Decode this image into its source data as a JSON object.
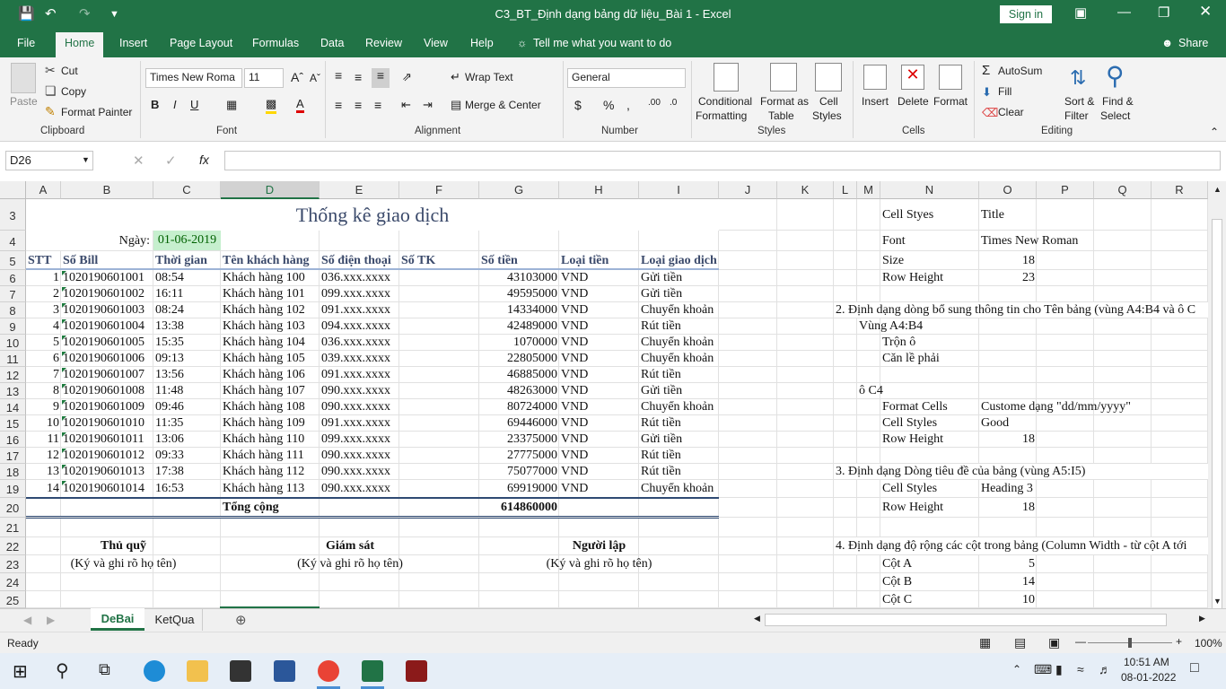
{
  "window": {
    "title": "C3_BT_Định dạng bảng dữ liệu_Bài 1  -  Excel",
    "signin": "Sign in"
  },
  "tabs": [
    "File",
    "Home",
    "Insert",
    "Page Layout",
    "Formulas",
    "Data",
    "Review",
    "View",
    "Help"
  ],
  "tell_me": "Tell me what you want to do",
  "share": "Share",
  "ribbon": {
    "paste": "Paste",
    "cut": "Cut",
    "copy": "Copy",
    "format_painter": "Format Painter",
    "clipboard": "Clipboard",
    "font_name": "Times New Roma",
    "font_size": "11",
    "font": "Font",
    "wrap": "Wrap Text",
    "merge": "Merge & Center",
    "alignment": "Alignment",
    "number_format": "General",
    "number": "Number",
    "cond1": "Conditional",
    "cond2": "Formatting",
    "fmt_table1": "Format as",
    "fmt_table2": "Table",
    "cell_styles1": "Cell",
    "cell_styles2": "Styles",
    "styles": "Styles",
    "insert": "Insert",
    "delete": "Delete",
    "format": "Format",
    "cells": "Cells",
    "autosum": "AutoSum",
    "fill": "Fill",
    "clear": "Clear",
    "sort1": "Sort &",
    "sort2": "Filter",
    "find1": "Find &",
    "find2": "Select",
    "editing": "Editing"
  },
  "namebox": "D26",
  "columns": [
    "A",
    "B",
    "C",
    "D",
    "E",
    "F",
    "G",
    "H",
    "I",
    "J",
    "K",
    "L",
    "M",
    "N",
    "O",
    "P",
    "Q",
    "R"
  ],
  "rows": [
    "3",
    "4",
    "5",
    "6",
    "7",
    "8",
    "9",
    "10",
    "11",
    "12",
    "13",
    "14",
    "15",
    "16",
    "17",
    "18",
    "19",
    "20",
    "21",
    "22",
    "23",
    "24",
    "25"
  ],
  "sheet": {
    "title": "Thống kê giao dịch",
    "date_label": "Ngày:",
    "date_value": "01-06-2019",
    "headers": [
      "STT",
      "Số Bill",
      "Thời gian",
      "Tên khách hàng",
      "Số điện thoại",
      "Số TK",
      "Số tiền",
      "Loại tiền",
      "Loại giao dịch"
    ],
    "data": [
      [
        "1",
        "1020190601001",
        "08:54",
        "Khách hàng 100",
        "036.xxx.xxxx",
        "",
        "43103000",
        "VND",
        "Gửi tiền"
      ],
      [
        "2",
        "1020190601002",
        "16:11",
        "Khách hàng 101",
        "099.xxx.xxxx",
        "",
        "49595000",
        "VND",
        "Gửi tiền"
      ],
      [
        "3",
        "1020190601003",
        "08:24",
        "Khách hàng 102",
        "091.xxx.xxxx",
        "",
        "14334000",
        "VND",
        "Chuyển khoản"
      ],
      [
        "4",
        "1020190601004",
        "13:38",
        "Khách hàng 103",
        "094.xxx.xxxx",
        "",
        "42489000",
        "VND",
        "Rút tiền"
      ],
      [
        "5",
        "1020190601005",
        "15:35",
        "Khách hàng 104",
        "036.xxx.xxxx",
        "",
        "1070000",
        "VND",
        "Chuyển khoản"
      ],
      [
        "6",
        "1020190601006",
        "09:13",
        "Khách hàng 105",
        "039.xxx.xxxx",
        "",
        "22805000",
        "VND",
        "Chuyển khoản"
      ],
      [
        "7",
        "1020190601007",
        "13:56",
        "Khách hàng 106",
        "091.xxx.xxxx",
        "",
        "46885000",
        "VND",
        "Rút tiền"
      ],
      [
        "8",
        "1020190601008",
        "11:48",
        "Khách hàng 107",
        "090.xxx.xxxx",
        "",
        "48263000",
        "VND",
        "Gửi tiền"
      ],
      [
        "9",
        "1020190601009",
        "09:46",
        "Khách hàng 108",
        "090.xxx.xxxx",
        "",
        "80724000",
        "VND",
        "Chuyển khoản"
      ],
      [
        "10",
        "1020190601010",
        "11:35",
        "Khách hàng 109",
        "091.xxx.xxxx",
        "",
        "69446000",
        "VND",
        "Rút tiền"
      ],
      [
        "11",
        "1020190601011",
        "13:06",
        "Khách hàng 110",
        "099.xxx.xxxx",
        "",
        "23375000",
        "VND",
        "Gửi tiền"
      ],
      [
        "12",
        "1020190601012",
        "09:33",
        "Khách hàng 111",
        "090.xxx.xxxx",
        "",
        "27775000",
        "VND",
        "Rút tiền"
      ],
      [
        "13",
        "1020190601013",
        "17:38",
        "Khách hàng 112",
        "090.xxx.xxxx",
        "",
        "75077000",
        "VND",
        "Rút tiền"
      ],
      [
        "14",
        "1020190601014",
        "16:53",
        "Khách hàng 113",
        "090.xxx.xxxx",
        "",
        "69919000",
        "VND",
        "Chuyển khoản"
      ]
    ],
    "total_label": "Tổng cộng",
    "total_value": "614860000",
    "sign": [
      {
        "role": "Thủ quỹ",
        "note": "(Ký và ghi rõ họ tên)"
      },
      {
        "role": "Giám sát",
        "note": "(Ký và ghi rõ họ tên)"
      },
      {
        "role": "Người lập",
        "note": "(Ký và ghi rõ họ tên)"
      }
    ]
  },
  "notes": {
    "cell_styes": "Cell Styes",
    "title": "Title",
    "font": "Font",
    "font_val": "Times New Roman",
    "size": "Size",
    "size_val": "18",
    "row_height": "Row Height",
    "row_height_val": "23",
    "s2": "2. Định dạng dòng bổ sung thông tin cho Tên bảng (vùng A4:B4 và ô C",
    "vung": "Vùng A4:B4",
    "tron": "Trộn ô",
    "canle": "Căn lề phải",
    "oc4": "ô C4",
    "fmt_cells": "Format Cells",
    "custome": "Custome dạng \"dd/mm/yyyy\"",
    "cell_styles": "Cell Styles",
    "good": "Good",
    "row_height2": "Row Height",
    "rh2": "18",
    "s3": "3. Định dạng Dòng tiêu đề của bảng (vùng A5:I5)",
    "cell_styles3": "Cell Styles",
    "heading3": "Heading 3",
    "row_height3": "Row Height",
    "rh3": "18",
    "s4": "4. Định dạng độ rộng các cột trong bảng (Column Width - từ cột A tới",
    "cota": "Cột A",
    "cota_v": "5",
    "cotb": "Cột B",
    "cotb_v": "14",
    "cotc": "Cột C",
    "cotc_v": "10"
  },
  "sheet_tabs": [
    "DeBai",
    "KetQua"
  ],
  "status": {
    "ready": "Ready",
    "zoom": "100%"
  },
  "clock": {
    "time": "10:51 AM",
    "date": "08-01-2022"
  },
  "colors": {
    "excel_green": "#217346",
    "good_fill": "#c6efce",
    "good_text": "#006100"
  }
}
